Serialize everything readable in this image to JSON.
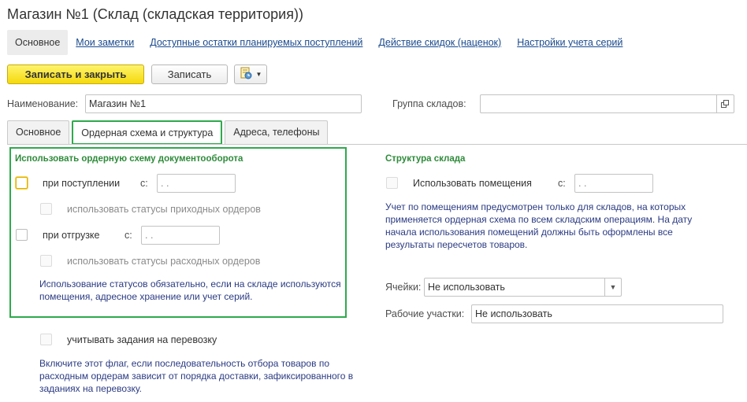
{
  "window": {
    "title": "Магазин №1 (Склад (складская территория))"
  },
  "navbar": {
    "items": [
      {
        "label": "Основное"
      },
      {
        "label": "Мои заметки"
      },
      {
        "label": "Доступные остатки планируемых поступлений"
      },
      {
        "label": "Действие скидок (наценок)"
      },
      {
        "label": "Настройки учета серий"
      }
    ]
  },
  "toolbar": {
    "save_close_label": "Записать и закрыть",
    "save_label": "Записать"
  },
  "form": {
    "name_label": "Наименование:",
    "name_value": "Магазин №1",
    "group_label": "Группа складов:",
    "group_value": ""
  },
  "tabs": [
    {
      "label": "Основное"
    },
    {
      "label": "Ордерная схема и структура"
    },
    {
      "label": "Адреса, телефоны"
    }
  ],
  "order_scheme": {
    "title": "Использовать ордерную схему документооборота",
    "on_receipt_label": "при поступлении",
    "on_receipt_from_label": "с:",
    "on_receipt_date": " .  .",
    "receipt_statuses_label": "использовать статусы приходных ордеров",
    "on_shipment_label": "при отгрузке",
    "on_shipment_from_label": "с:",
    "on_shipment_date": " .  .",
    "shipment_statuses_label": "использовать статусы расходных ордеров",
    "note": "Использование статусов обязательно, если на складе используются помещения, адресное хранение или учет серий."
  },
  "transport": {
    "label": "учитывать задания на перевозку",
    "note": "Включите этот флаг, если последовательность отбора товаров по расходным ордерам зависит от порядка доставки, зафиксированного в заданиях на перевозку."
  },
  "structure": {
    "title": "Структура склада",
    "use_rooms_label": "Использовать помещения",
    "use_rooms_from_label": "с:",
    "use_rooms_date": " .  .",
    "note": "Учет по помещениям предусмотрен только для складов, на которых применяется ордерная схема по всем складским операциям. На дату начала использования помещений должны быть оформлены все результаты пересчетов товаров.",
    "cells_label": "Ячейки:",
    "cells_value": "Не использовать",
    "work_areas_label": "Рабочие участки:",
    "work_areas_value": "Не использовать"
  },
  "colors": {
    "accent_green": "#2eaa4c",
    "link_blue": "#1a4a8e",
    "note_blue": "#2b3b82",
    "primary_yellow": "#f4d90d"
  }
}
